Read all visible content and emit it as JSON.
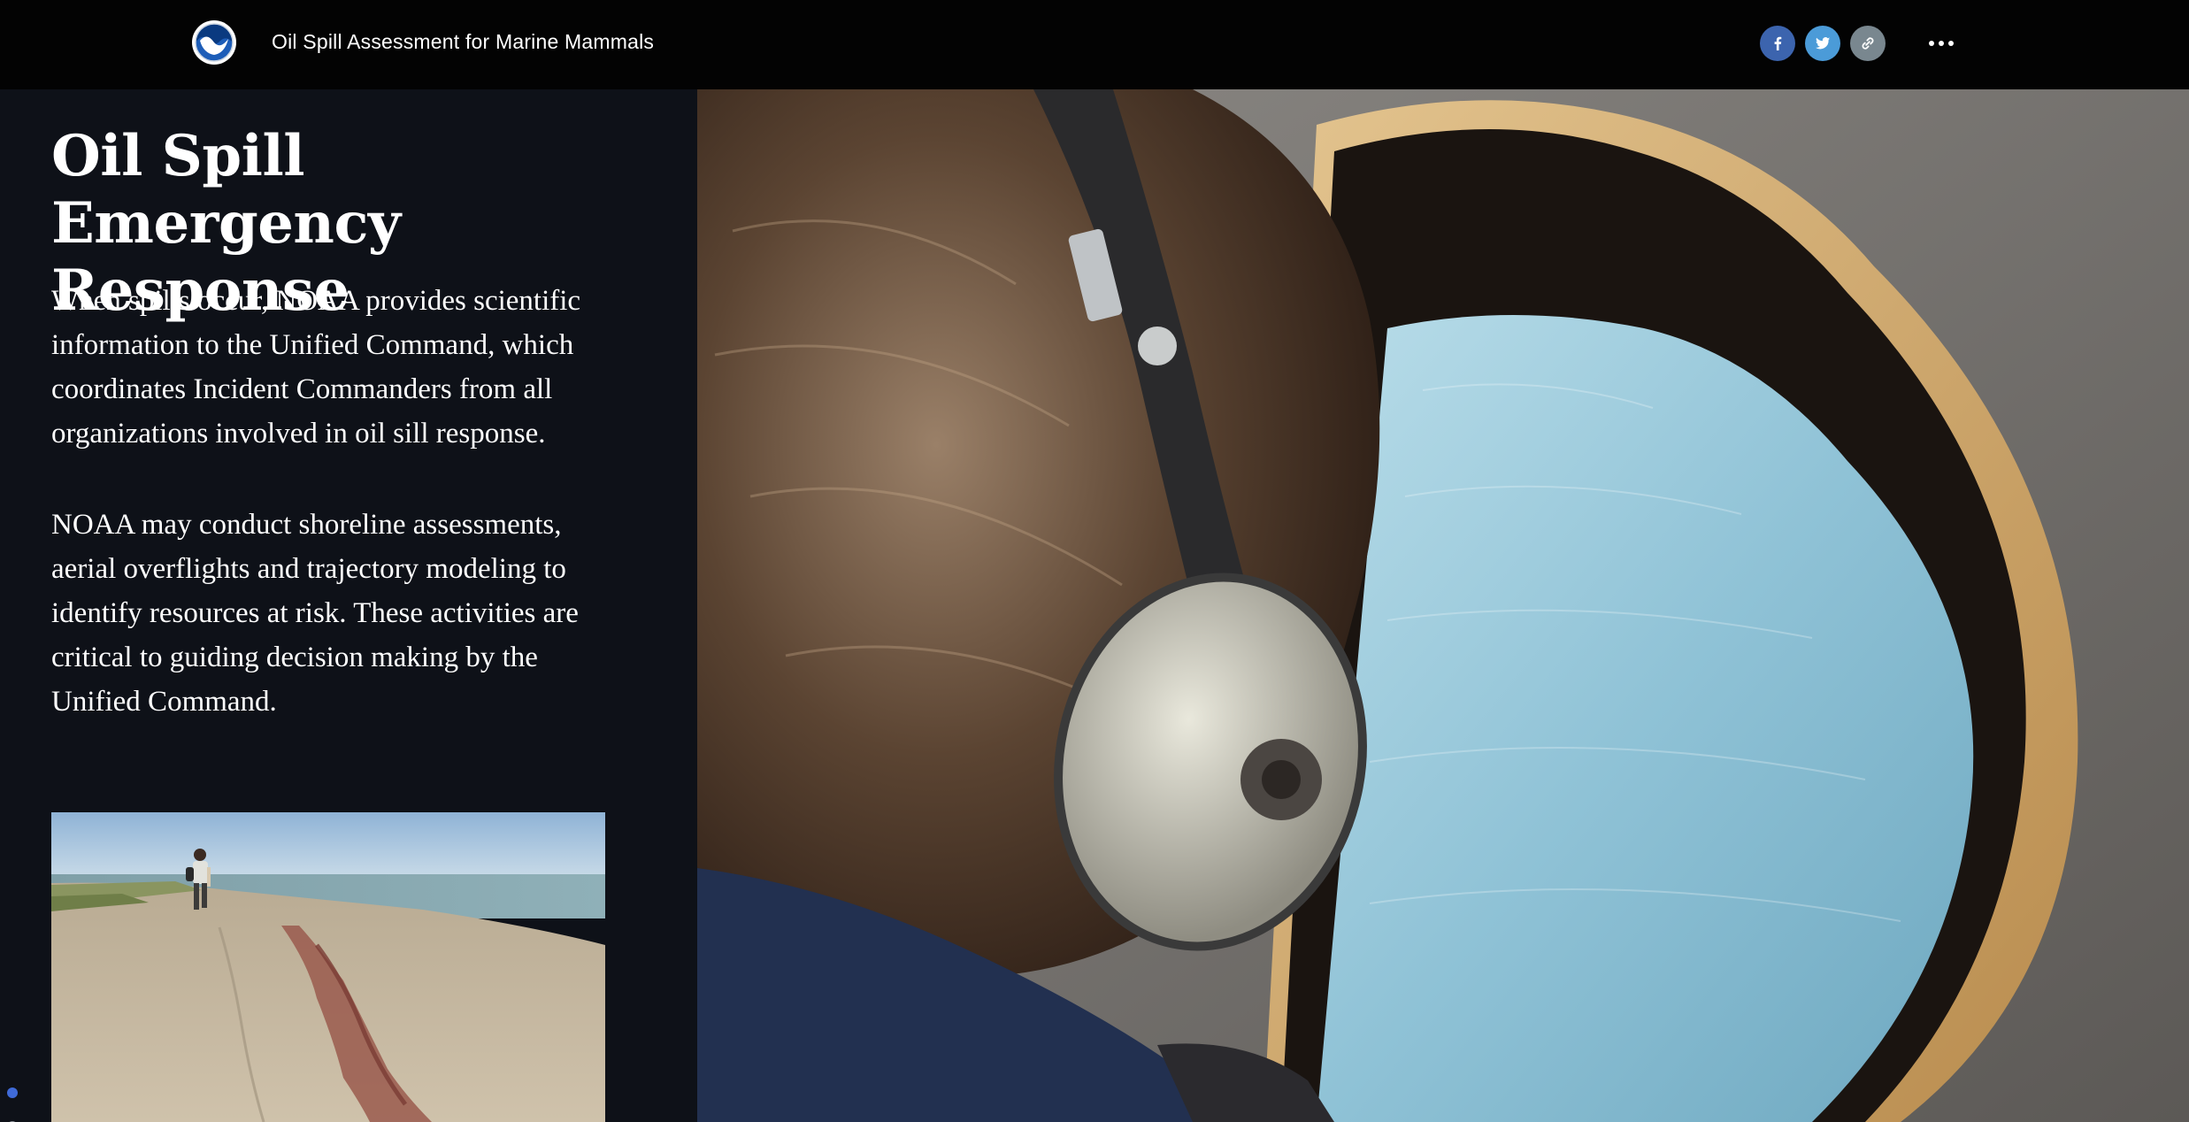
{
  "header": {
    "title": "Oil Spill Assessment for Marine Mammals",
    "logo_icon": "noaa-logo-icon",
    "share": {
      "facebook_icon": "facebook-icon",
      "twitter_icon": "twitter-icon",
      "link_icon": "link-icon"
    },
    "more_icon": "more-options-icon"
  },
  "narrative": {
    "heading": "Oil Spill Emergency Response",
    "paragraphs": [
      "When spills occur, NOAA provides scientific information to the Unified Command, which coordinates Incident Commanders from all organizations involved in oil sill response.",
      "NOAA may conduct shoreline assessments, aerial overflights and trajectory modeling to identify resources at risk. These activities are critical to guiding decision making by the Unified Command."
    ]
  },
  "progress": {
    "total": 3,
    "active_index": 1
  },
  "colors": {
    "header_bg": "#030303",
    "panel_bg": "#0e1118",
    "active_dot": "#3f6ad8",
    "inactive_dot": "#8b8f96",
    "facebook": "#3c64ae",
    "twitter": "#4b9bd8",
    "link": "#79878f"
  }
}
